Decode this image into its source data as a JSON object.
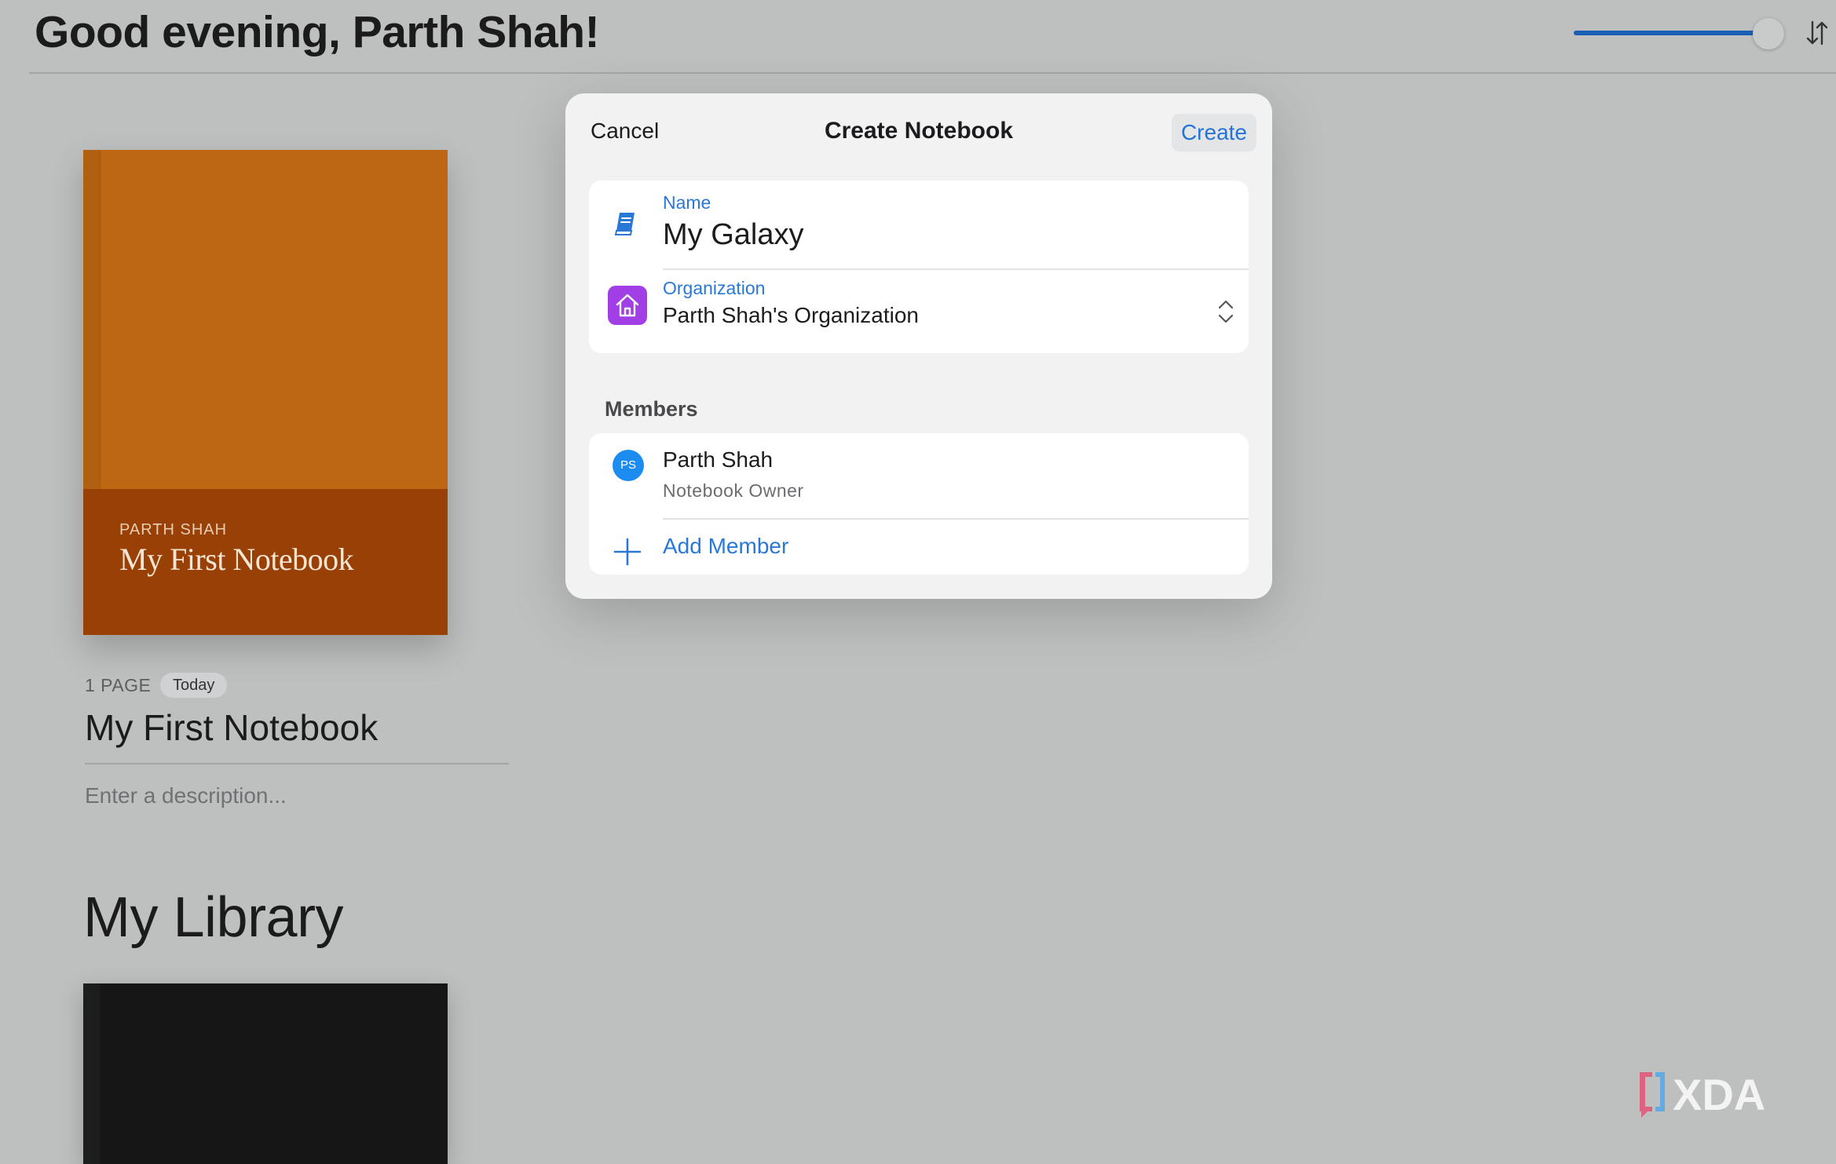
{
  "header": {
    "greeting": "Good evening, Parth Shah!",
    "zoom_slider_value": 0.85
  },
  "notebook": {
    "cover_author": "PARTH SHAH",
    "cover_title": "My First Notebook",
    "cover_color": "#bd6714",
    "cover_band_color": "#984006",
    "page_count": "1 PAGE",
    "date_badge": "Today",
    "title": "My First Notebook",
    "description_placeholder": "Enter a description..."
  },
  "library": {
    "title": "My Library"
  },
  "modal": {
    "cancel_label": "Cancel",
    "title": "Create Notebook",
    "create_label": "Create",
    "name_label": "Name",
    "name_value": "My Galaxy",
    "organization_label": "Organization",
    "organization_value": "Parth Shah's Organization",
    "members_header": "Members",
    "members": [
      {
        "initials": "PS",
        "name": "Parth Shah",
        "role": "Notebook Owner"
      }
    ],
    "add_member_label": "Add Member"
  },
  "colors": {
    "accent": "#2a78d6",
    "org_icon_bg": "#a23ee6",
    "avatar_bg": "#1d8cf0"
  },
  "watermark": "XDA"
}
